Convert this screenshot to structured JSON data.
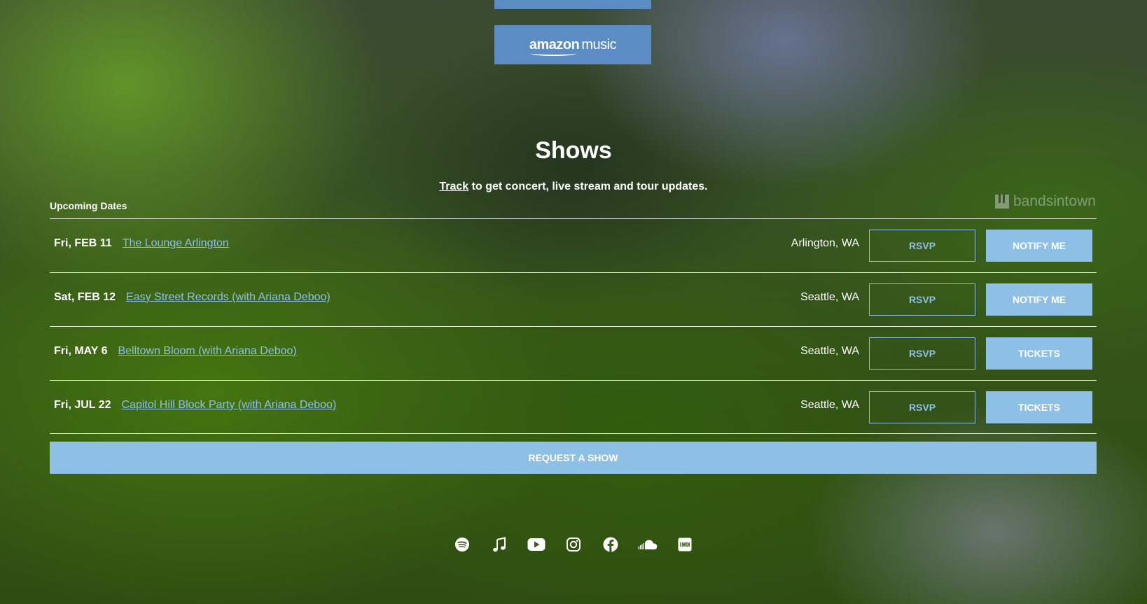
{
  "streaming": {
    "amazon_brand": "amazon",
    "amazon_suffix": "music"
  },
  "shows": {
    "title": "Shows",
    "track_link": "Track",
    "track_text": " to get concert, live stream and tour updates.",
    "upcoming_label": "Upcoming Dates",
    "provider_logo": "bandsintown"
  },
  "events": [
    {
      "date": "Fri, FEB 11",
      "venue": "The Lounge Arlington",
      "location": "Arlington, WA",
      "rsvp": "RSVP",
      "action": "NOTIFY ME"
    },
    {
      "date": "Sat, FEB 12",
      "venue": "Easy Street Records (with Ariana Deboo)",
      "location": "Seattle, WA",
      "rsvp": "RSVP",
      "action": "NOTIFY ME"
    },
    {
      "date": "Fri, MAY 6",
      "venue": "Belltown Bloom (with Ariana Deboo)",
      "location": "Seattle, WA",
      "rsvp": "RSVP",
      "action": "TICKETS"
    },
    {
      "date": "Fri, JUL 22",
      "venue": "Capitol Hill Block Party (with Ariana Deboo)",
      "location": "Seattle, WA",
      "rsvp": "RSVP",
      "action": "TICKETS"
    }
  ],
  "request_show": "REQUEST A SHOW",
  "social_icons": [
    "spotify-icon",
    "music-note-icon",
    "youtube-icon",
    "instagram-icon",
    "facebook-icon",
    "soundcloud-icon",
    "imdb-icon"
  ],
  "colors": {
    "button_blue": "#5b8dc4",
    "accent_light_blue": "#8ec0e6",
    "text": "#ffffff"
  }
}
